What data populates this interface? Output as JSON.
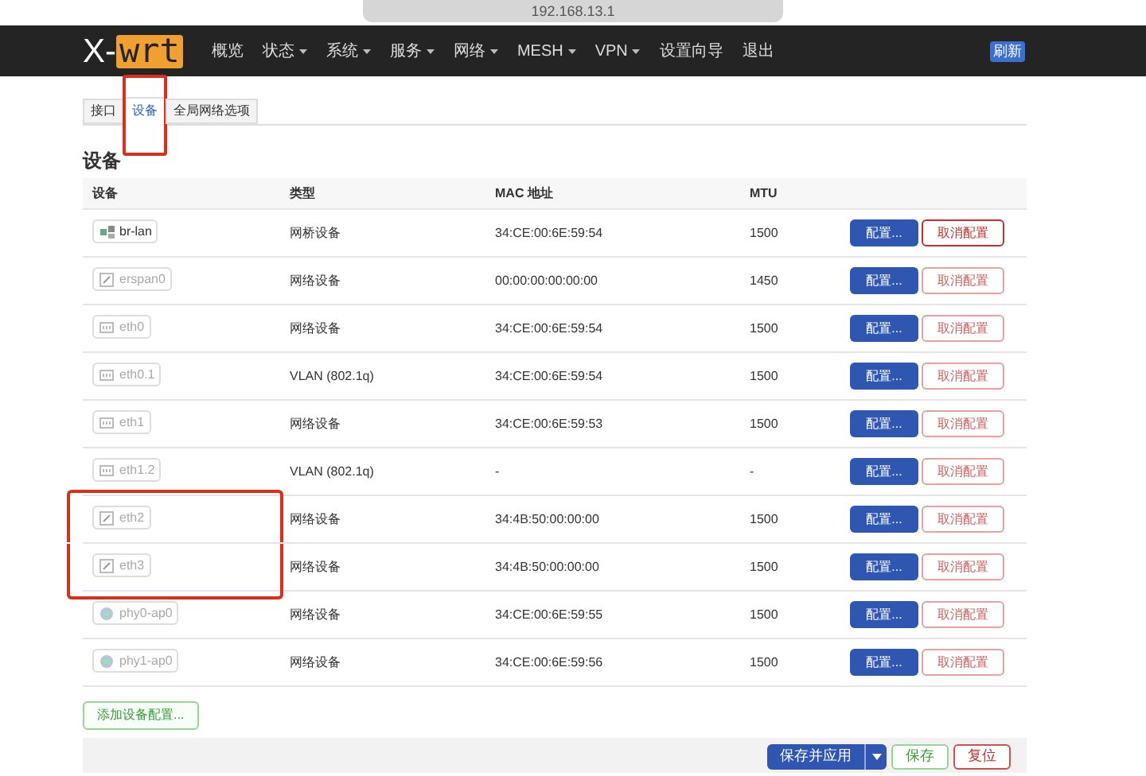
{
  "address_bar": {
    "url": "192.168.13.1"
  },
  "navbar": {
    "logo": {
      "prefix": "X-",
      "suffix": "wrt"
    },
    "menu": [
      {
        "label": "概览",
        "dropdown": false
      },
      {
        "label": "状态",
        "dropdown": true
      },
      {
        "label": "系统",
        "dropdown": true
      },
      {
        "label": "服务",
        "dropdown": true
      },
      {
        "label": "网络",
        "dropdown": true
      },
      {
        "label": "MESH",
        "dropdown": true
      },
      {
        "label": "VPN",
        "dropdown": true
      },
      {
        "label": "设置向导",
        "dropdown": false
      },
      {
        "label": "退出",
        "dropdown": false
      }
    ],
    "badge": "刷新"
  },
  "tabs": [
    {
      "label": "接口",
      "selected": false,
      "highlighted": false
    },
    {
      "label": "设备",
      "selected": true,
      "highlighted": true
    },
    {
      "label": "全局网络选项",
      "selected": false,
      "highlighted": false
    }
  ],
  "section_title": "设备",
  "table": {
    "columns": [
      "设备",
      "类型",
      "MAC 地址",
      "MTU"
    ],
    "rows": [
      {
        "device": "br-lan",
        "kind": "bridge",
        "active": true,
        "highlighted": false,
        "type": "网桥设备",
        "mac": "34:CE:00:6E:59:54",
        "mtu": "1500",
        "configure": "配置...",
        "unconfigure": "取消配置"
      },
      {
        "device": "erspan0",
        "kind": "tunnel",
        "active": false,
        "highlighted": false,
        "type": "网络设备",
        "mac": "00:00:00:00:00:00",
        "mtu": "1450",
        "configure": "配置...",
        "unconfigure": "取消配置"
      },
      {
        "device": "eth0",
        "kind": "ethernet",
        "active": false,
        "highlighted": false,
        "type": "网络设备",
        "mac": "34:CE:00:6E:59:54",
        "mtu": "1500",
        "configure": "配置...",
        "unconfigure": "取消配置"
      },
      {
        "device": "eth0.1",
        "kind": "ethernet",
        "active": false,
        "highlighted": false,
        "type": "VLAN (802.1q)",
        "mac": "34:CE:00:6E:59:54",
        "mtu": "1500",
        "configure": "配置...",
        "unconfigure": "取消配置"
      },
      {
        "device": "eth1",
        "kind": "ethernet",
        "active": false,
        "highlighted": false,
        "type": "网络设备",
        "mac": "34:CE:00:6E:59:53",
        "mtu": "1500",
        "configure": "配置...",
        "unconfigure": "取消配置"
      },
      {
        "device": "eth1.2",
        "kind": "ethernet",
        "active": false,
        "highlighted": false,
        "type": "VLAN (802.1q)",
        "mac": "-",
        "mtu": "-",
        "configure": "配置...",
        "unconfigure": "取消配置"
      },
      {
        "device": "eth2",
        "kind": "tunnel",
        "active": false,
        "highlighted": true,
        "type": "网络设备",
        "mac": "34:4B:50:00:00:00",
        "mtu": "1500",
        "configure": "配置...",
        "unconfigure": "取消配置"
      },
      {
        "device": "eth3",
        "kind": "tunnel",
        "active": false,
        "highlighted": true,
        "type": "网络设备",
        "mac": "34:4B:50:00:00:00",
        "mtu": "1500",
        "configure": "配置...",
        "unconfigure": "取消配置"
      },
      {
        "device": "phy0-ap0",
        "kind": "wireless",
        "active": false,
        "highlighted": false,
        "type": "网络设备",
        "mac": "34:CE:00:6E:59:55",
        "mtu": "1500",
        "configure": "配置...",
        "unconfigure": "取消配置"
      },
      {
        "device": "phy1-ap0",
        "kind": "wireless",
        "active": false,
        "highlighted": false,
        "type": "网络设备",
        "mac": "34:CE:00:6E:59:56",
        "mtu": "1500",
        "configure": "配置...",
        "unconfigure": "取消配置"
      }
    ]
  },
  "add_button": "添加设备配置...",
  "footer": {
    "save_apply": "保存并应用",
    "save": "保存",
    "reset": "复位"
  }
}
